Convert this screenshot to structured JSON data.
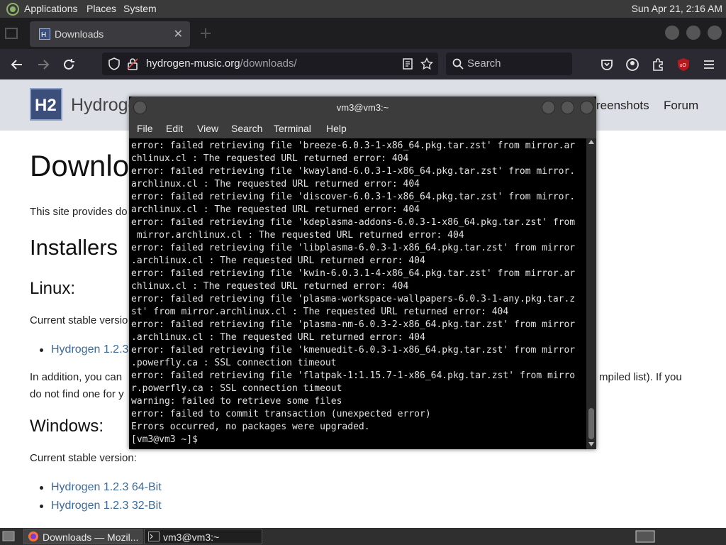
{
  "top_panel": {
    "menus": [
      "Applications",
      "Places",
      "System"
    ],
    "clock": "Sun Apr 21,  2:16 AM"
  },
  "browser": {
    "tab_title": "Downloads",
    "url_domain": "hydrogen-music.org",
    "url_path": "/downloads/",
    "search_placeholder": "Search"
  },
  "page": {
    "site_name": "Hydrogen",
    "nav": [
      "reenshots",
      "Forum"
    ],
    "heading": "Downloa",
    "intro": "This site provides do",
    "installers_heading": "Installers",
    "linux_heading": "Linux:",
    "linux_current": "Current stable versio",
    "linux_link": "Hydrogen 1.2.3",
    "addition_text_left": "In addition, you can",
    "addition_text_right": "mpiled list). If you",
    "addition_text_line2": "do not find one for y",
    "windows_heading": "Windows:",
    "windows_current": "Current stable version:",
    "windows_links": [
      "Hydrogen 1.2.3 64-Bit",
      "Hydrogen 1.2.3 32-Bit"
    ]
  },
  "terminal": {
    "title": "vm3@vm3:~",
    "menu": [
      "File",
      "Edit",
      "View",
      "Search",
      "Terminal",
      "Help"
    ],
    "lines": [
      "error: failed retrieving file 'breeze-6.0.3-1-x86_64.pkg.tar.zst' from mirror.ar",
      "chlinux.cl : The requested URL returned error: 404",
      "error: failed retrieving file 'kwayland-6.0.3-1-x86_64.pkg.tar.zst' from mirror.",
      "archlinux.cl : The requested URL returned error: 404",
      "error: failed retrieving file 'discover-6.0.3-1-x86_64.pkg.tar.zst' from mirror.",
      "archlinux.cl : The requested URL returned error: 404",
      "error: failed retrieving file 'kdeplasma-addons-6.0.3-1-x86_64.pkg.tar.zst' from",
      " mirror.archlinux.cl : The requested URL returned error: 404",
      "error: failed retrieving file 'libplasma-6.0.3-1-x86_64.pkg.tar.zst' from mirror",
      ".archlinux.cl : The requested URL returned error: 404",
      "error: failed retrieving file 'kwin-6.0.3.1-4-x86_64.pkg.tar.zst' from mirror.ar",
      "chlinux.cl : The requested URL returned error: 404",
      "error: failed retrieving file 'plasma-workspace-wallpapers-6.0.3-1-any.pkg.tar.z",
      "st' from mirror.archlinux.cl : The requested URL returned error: 404",
      "error: failed retrieving file 'plasma-nm-6.0.3-2-x86_64.pkg.tar.zst' from mirror",
      ".archlinux.cl : The requested URL returned error: 404",
      "error: failed retrieving file 'kmenuedit-6.0.3-1-x86_64.pkg.tar.zst' from mirror",
      ".powerfly.ca : SSL connection timeout",
      "error: failed retrieving file 'flatpak-1:1.15.7-1-x86_64.pkg.tar.zst' from mirro",
      "r.powerfly.ca : SSL connection timeout",
      "warning: failed to retrieve some files",
      "error: failed to commit transaction (unexpected error)",
      "Errors occurred, no packages were upgraded.",
      "[vm3@vm3 ~]$ "
    ]
  },
  "taskbar": {
    "tasks": [
      "Downloads — Mozil...",
      "vm3@vm3:~"
    ]
  }
}
